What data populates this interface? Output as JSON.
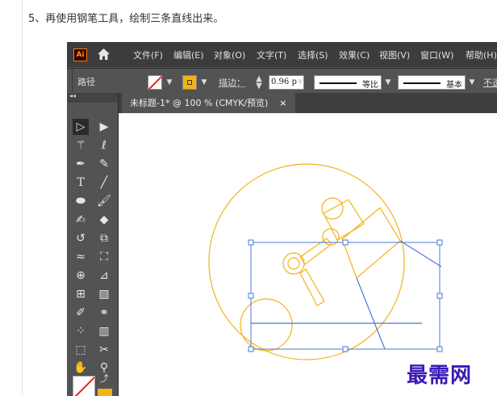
{
  "step_text": "5、再使用钢笔工具，绘制三条直线出来。",
  "app": {
    "logo": "Ai",
    "menu": [
      "文件(F)",
      "编辑(E)",
      "对象(O)",
      "文字(T)",
      "选择(S)",
      "效果(C)",
      "视图(V)",
      "窗口(W)",
      "帮助(H)"
    ]
  },
  "options_bar": {
    "object_type": "路径",
    "stroke_label": "描边：",
    "stroke_weight": "0.96 p",
    "profile_label": "等比",
    "brush_label": "基本",
    "opacity_label": "不透"
  },
  "document": {
    "tab_title": "未标题-1* @ 100 % (CMYK/预览)",
    "close_glyph": "×"
  },
  "watermark": "最需网",
  "colors": {
    "artwork_stroke": "#f3b21a",
    "selection": "#4a78d6",
    "watermark": "#3a18b8"
  },
  "icons": {
    "home": "home-icon",
    "fill": "fill-none-swatch",
    "stroke": "stroke-swatch"
  }
}
